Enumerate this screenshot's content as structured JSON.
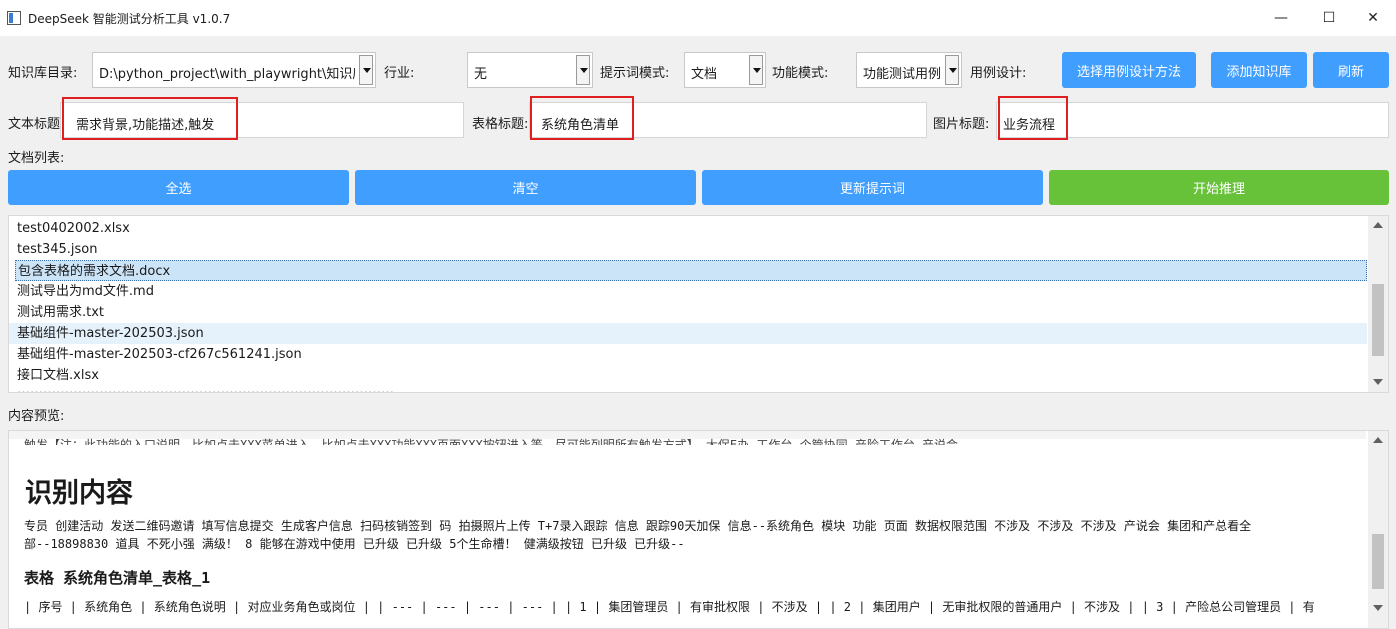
{
  "window": {
    "title": "DeepSeek 智能测试分析工具 v1.0.7",
    "minimize": "—",
    "maximize": "☐",
    "close": "✕"
  },
  "controls": {
    "kb_dir_label": "知识库目录:",
    "kb_dir_value": "D:\\python_project\\with_playwright\\知识库",
    "industry_label": "行业:",
    "industry_value": "无",
    "prompt_mode_label": "提示词模式:",
    "prompt_mode_value": "文档",
    "func_mode_label": "功能模式:",
    "func_mode_value": "功能测试用例",
    "case_design_label": "用例设计:",
    "select_method_button": "选择用例设计方法",
    "add_kb_button": "添加知识库",
    "refresh_button": "刷新"
  },
  "titles": {
    "text_title_label": "文本标题",
    "text_title_value": "需求背景,功能描述,触发",
    "table_title_label": "表格标题:",
    "table_title_value": "系统角色清单",
    "image_title_label": "图片标题:",
    "image_title_value": "业务流程"
  },
  "doc_list": {
    "label": "文档列表:",
    "select_all": "全选",
    "clear": "清空",
    "update_prompt": "更新提示词",
    "start_inference": "开始推理",
    "items": [
      "test0402002.xlsx",
      "test345.json",
      "包含表格的需求文档.docx",
      "测试导出为md文件.md",
      "测试用需求.txt",
      "基础组件-master-202503.json",
      "基础组件-master-202503-cf267c561241.json",
      "接口文档.xlsx",
      "……………………………………………………………………………"
    ]
  },
  "preview": {
    "label": "内容预览:",
    "line_top": "触发【注：此功能的入口说明，比如点击XXX菜单进入、比如点击XXX功能XXX页面XXX按钮进入等，尽可能列明所有触发方式】 大保E办-工作台-个管协同-产险工作台-产说会",
    "heading": "识别内容",
    "para_1": "专员 创建活动 发送二维码邀请 填写信息提交 生成客户信息 扫码核销签到 码 拍摄照片上传 T+7录入跟踪 信息 跟踪90天加保 信息--系统角色 模块 功能 页面 数据权限范围 不涉及 不涉及 不涉及 产说会 集团和产总看全",
    "para_2": "部--18898830 道具 不死小强 满级！ 8 能够在游戏中使用 已升级 已升级 5个生命槽！ 健满级按钮 已升级 已升级--",
    "table_heading": "表格 系统角色清单_表格_1",
    "table_line": "| 序号 | 系统角色 | 系统角色说明 | 对应业务角色或岗位 | | --- | --- | --- | --- | | 1 | 集团管理员 | 有审批权限 | 不涉及 | | 2 | 集团用户 | 无审批权限的普通用户 | 不涉及 | | 3 | 产险总公司管理员 | 有"
  },
  "colors": {
    "primary_button": "#409eff",
    "success_button": "#67c23a",
    "highlight_box": "#e02020",
    "selected_row": "#cce4f7"
  }
}
